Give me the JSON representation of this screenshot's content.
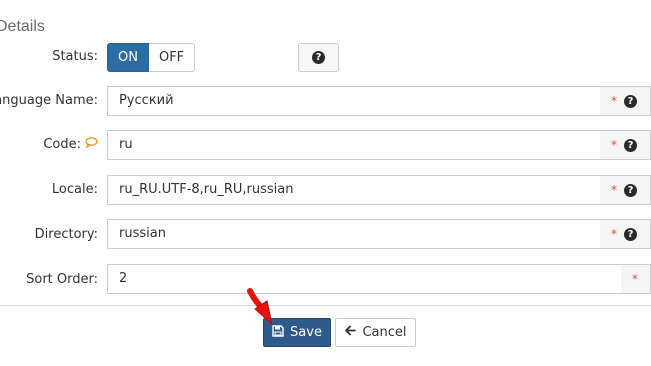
{
  "section": {
    "title": "Details"
  },
  "status": {
    "label": "Status:",
    "on_label": "ON",
    "off_label": "OFF",
    "selected": "ON",
    "help_icon": "question-circle-icon"
  },
  "fields": [
    {
      "label": "Language Name:",
      "value": "Русский",
      "required": "*",
      "help_icon": "question-circle-icon"
    },
    {
      "label": "Code:",
      "value": "ru",
      "required": "*",
      "help_icon": "question-circle-icon",
      "label_icon": "speech-bubble-icon"
    },
    {
      "label": "Locale:",
      "value": "ru_RU.UTF-8,ru_RU,russian",
      "required": "*",
      "help_icon": "question-circle-icon"
    },
    {
      "label": "Directory:",
      "value": "russian",
      "required": "*",
      "help_icon": "question-circle-icon"
    },
    {
      "label": "Sort Order:",
      "value": "2",
      "required": "*"
    }
  ],
  "actions": {
    "save_label": "Save",
    "save_icon": "floppy-disk-icon",
    "cancel_label": "Cancel",
    "cancel_icon": "arrow-left-icon"
  },
  "colors": {
    "primary": "#2d6ca2",
    "save": "#2e5c8a",
    "required": "#d9534f",
    "pointer": "#e8130f",
    "bubble": "#f0922e"
  },
  "help_glyph": "?"
}
